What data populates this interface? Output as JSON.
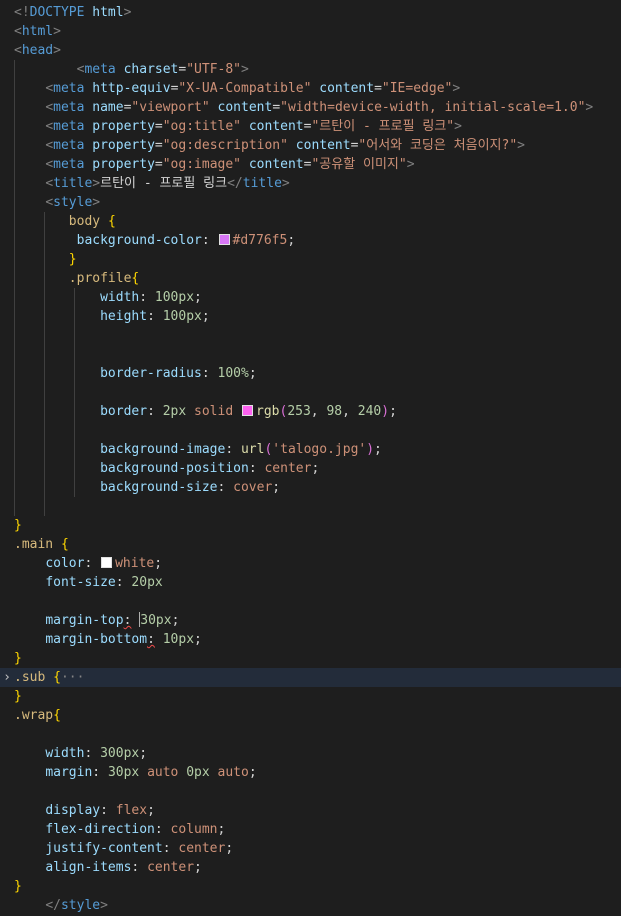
{
  "editor": {
    "theme": {
      "background": "#1e1e1e",
      "current_line": "#232c3a",
      "indent_guide": "#404040"
    },
    "fold_icons": {
      "collapsed": "chevron-right-icon"
    },
    "swatches": {
      "body_bg": "#d776f5",
      "profile_border": "#fd62f0",
      "main_color": "#ffffff"
    },
    "lines": [
      [
        [
          "punct",
          "<!"
        ],
        [
          "tag",
          "DOCTYPE"
        ],
        [
          "text",
          " "
        ],
        [
          "attr",
          "html"
        ],
        [
          "punct",
          ">"
        ]
      ],
      [
        [
          "punct",
          "<"
        ],
        [
          "tag",
          "html"
        ],
        [
          "punct",
          ">"
        ]
      ],
      [
        [
          "punct",
          "<"
        ],
        [
          "tag",
          "head"
        ],
        [
          "punct",
          ">"
        ]
      ],
      [
        [
          "text",
          "        "
        ],
        [
          "punct",
          "<"
        ],
        [
          "tag",
          "meta"
        ],
        [
          "text",
          " "
        ],
        [
          "attr",
          "charset"
        ],
        [
          "text",
          "="
        ],
        [
          "str",
          "\"UTF-8\""
        ],
        [
          "punct",
          ">"
        ]
      ],
      [
        [
          "text",
          "    "
        ],
        [
          "punct",
          "<"
        ],
        [
          "tag",
          "meta"
        ],
        [
          "text",
          " "
        ],
        [
          "attr",
          "http-equiv"
        ],
        [
          "text",
          "="
        ],
        [
          "str",
          "\"X-UA-Compatible\""
        ],
        [
          "text",
          " "
        ],
        [
          "attr",
          "content"
        ],
        [
          "text",
          "="
        ],
        [
          "str",
          "\"IE=edge\""
        ],
        [
          "punct",
          ">"
        ]
      ],
      [
        [
          "text",
          "    "
        ],
        [
          "punct",
          "<"
        ],
        [
          "tag",
          "meta"
        ],
        [
          "text",
          " "
        ],
        [
          "attr",
          "name"
        ],
        [
          "text",
          "="
        ],
        [
          "str",
          "\"viewport\""
        ],
        [
          "text",
          " "
        ],
        [
          "attr",
          "content"
        ],
        [
          "text",
          "="
        ],
        [
          "str",
          "\"width=device-width, initial-scale=1.0\""
        ],
        [
          "punct",
          ">"
        ]
      ],
      [
        [
          "text",
          "    "
        ],
        [
          "punct",
          "<"
        ],
        [
          "tag",
          "meta"
        ],
        [
          "text",
          " "
        ],
        [
          "attr",
          "property"
        ],
        [
          "text",
          "="
        ],
        [
          "str",
          "\"og:title\""
        ],
        [
          "text",
          " "
        ],
        [
          "attr",
          "content"
        ],
        [
          "text",
          "="
        ],
        [
          "str",
          "\"르탄이 - 프로필 링크\""
        ],
        [
          "punct",
          ">"
        ]
      ],
      [
        [
          "text",
          "    "
        ],
        [
          "punct",
          "<"
        ],
        [
          "tag",
          "meta"
        ],
        [
          "text",
          " "
        ],
        [
          "attr",
          "property"
        ],
        [
          "text",
          "="
        ],
        [
          "str",
          "\"og:description\""
        ],
        [
          "text",
          " "
        ],
        [
          "attr",
          "content"
        ],
        [
          "text",
          "="
        ],
        [
          "str",
          "\"어서와 코딩은 처음이지?\""
        ],
        [
          "punct",
          ">"
        ]
      ],
      [
        [
          "text",
          "    "
        ],
        [
          "punct",
          "<"
        ],
        [
          "tag",
          "meta"
        ],
        [
          "text",
          " "
        ],
        [
          "attr",
          "property"
        ],
        [
          "text",
          "="
        ],
        [
          "str",
          "\"og:image\""
        ],
        [
          "text",
          " "
        ],
        [
          "attr",
          "content"
        ],
        [
          "text",
          "="
        ],
        [
          "str",
          "\"공유할 이미지\""
        ],
        [
          "punct",
          ">"
        ]
      ],
      [
        [
          "text",
          "    "
        ],
        [
          "punct",
          "<"
        ],
        [
          "tag",
          "title"
        ],
        [
          "punct",
          ">"
        ],
        [
          "text",
          "르탄이 - 프로필 링크"
        ],
        [
          "punct",
          "</"
        ],
        [
          "tag",
          "title"
        ],
        [
          "punct",
          ">"
        ]
      ],
      [
        [
          "text",
          "    "
        ],
        [
          "punct",
          "<"
        ],
        [
          "tag",
          "style"
        ],
        [
          "punct",
          ">"
        ]
      ],
      [
        [
          "text",
          "       "
        ],
        [
          "sel",
          "body"
        ],
        [
          "text",
          " "
        ],
        [
          "brace",
          "{"
        ]
      ],
      [
        [
          "text",
          "        "
        ],
        [
          "prop",
          "background-color"
        ],
        [
          "text",
          ": "
        ],
        [
          "swatch",
          "body_bg"
        ],
        [
          "val",
          "#d776f5"
        ],
        [
          "text",
          ";"
        ]
      ],
      [
        [
          "text",
          "       "
        ],
        [
          "brace",
          "}"
        ]
      ],
      [
        [
          "text",
          "       "
        ],
        [
          "sel",
          ".profile"
        ],
        [
          "brace",
          "{"
        ]
      ],
      [
        [
          "text",
          "           "
        ],
        [
          "prop",
          "width"
        ],
        [
          "text",
          ": "
        ],
        [
          "num",
          "100px"
        ],
        [
          "text",
          ";"
        ]
      ],
      [
        [
          "text",
          "           "
        ],
        [
          "prop",
          "height"
        ],
        [
          "text",
          ": "
        ],
        [
          "num",
          "100px"
        ],
        [
          "text",
          ";"
        ]
      ],
      [],
      [],
      [
        [
          "text",
          "           "
        ],
        [
          "prop",
          "border-radius"
        ],
        [
          "text",
          ": "
        ],
        [
          "num",
          "100%"
        ],
        [
          "text",
          ";"
        ]
      ],
      [],
      [
        [
          "text",
          "           "
        ],
        [
          "prop",
          "border"
        ],
        [
          "text",
          ": "
        ],
        [
          "num",
          "2px"
        ],
        [
          "text",
          " "
        ],
        [
          "val",
          "solid"
        ],
        [
          "text",
          " "
        ],
        [
          "swatch",
          "profile_border"
        ],
        [
          "func",
          "rgb"
        ],
        [
          "brace2",
          "("
        ],
        [
          "num",
          "253"
        ],
        [
          "text",
          ", "
        ],
        [
          "num",
          "98"
        ],
        [
          "text",
          ", "
        ],
        [
          "num",
          "240"
        ],
        [
          "brace2",
          ")"
        ],
        [
          "text",
          ";"
        ]
      ],
      [],
      [
        [
          "text",
          "           "
        ],
        [
          "prop",
          "background-image"
        ],
        [
          "text",
          ": "
        ],
        [
          "func",
          "url"
        ],
        [
          "brace2",
          "("
        ],
        [
          "str",
          "'talogo.jpg'"
        ],
        [
          "brace2",
          ")"
        ],
        [
          "text",
          ";"
        ]
      ],
      [
        [
          "text",
          "           "
        ],
        [
          "prop",
          "background-position"
        ],
        [
          "text",
          ": "
        ],
        [
          "val",
          "center"
        ],
        [
          "text",
          ";"
        ]
      ],
      [
        [
          "text",
          "           "
        ],
        [
          "prop",
          "background-size"
        ],
        [
          "text",
          ": "
        ],
        [
          "val",
          "cover"
        ],
        [
          "text",
          ";"
        ]
      ],
      [],
      [
        [
          "brace",
          "}"
        ]
      ],
      [
        [
          "sel",
          ".main"
        ],
        [
          "text",
          " "
        ],
        [
          "brace",
          "{"
        ]
      ],
      [
        [
          "text",
          "    "
        ],
        [
          "prop",
          "color"
        ],
        [
          "text",
          ": "
        ],
        [
          "swatch",
          "main_color"
        ],
        [
          "val",
          "white"
        ],
        [
          "text",
          ";"
        ]
      ],
      [
        [
          "text",
          "    "
        ],
        [
          "prop",
          "font-size"
        ],
        [
          "text",
          ": "
        ],
        [
          "num",
          "20px"
        ]
      ],
      [],
      [
        [
          "text",
          "    "
        ],
        [
          "prop",
          "margin-top"
        ],
        [
          "squig",
          ":"
        ],
        [
          "text",
          " "
        ],
        [
          "cursor",
          ""
        ],
        [
          "num",
          "30px"
        ],
        [
          "text",
          ";"
        ]
      ],
      [
        [
          "text",
          "    "
        ],
        [
          "prop",
          "margin-bottom"
        ],
        [
          "squig",
          ":"
        ],
        [
          "text",
          " "
        ],
        [
          "num",
          "10px"
        ],
        [
          "text",
          ";"
        ]
      ],
      [
        [
          "brace",
          "}"
        ]
      ],
      [
        [
          "sel",
          ".sub"
        ],
        [
          "text",
          " "
        ],
        [
          "brace",
          "{"
        ],
        [
          "ellipsis",
          "···"
        ]
      ],
      [
        [
          "brace",
          "}"
        ]
      ],
      [
        [
          "sel",
          ".wrap"
        ],
        [
          "brace",
          "{"
        ]
      ],
      [],
      [
        [
          "text",
          "    "
        ],
        [
          "prop",
          "width"
        ],
        [
          "text",
          ": "
        ],
        [
          "num",
          "300px"
        ],
        [
          "text",
          ";"
        ]
      ],
      [
        [
          "text",
          "    "
        ],
        [
          "prop",
          "margin"
        ],
        [
          "text",
          ": "
        ],
        [
          "num",
          "30px"
        ],
        [
          "text",
          " "
        ],
        [
          "val",
          "auto"
        ],
        [
          "text",
          " "
        ],
        [
          "num",
          "0px"
        ],
        [
          "text",
          " "
        ],
        [
          "val",
          "auto"
        ],
        [
          "text",
          ";"
        ]
      ],
      [],
      [
        [
          "text",
          "    "
        ],
        [
          "prop",
          "display"
        ],
        [
          "text",
          ": "
        ],
        [
          "val",
          "flex"
        ],
        [
          "text",
          ";"
        ]
      ],
      [
        [
          "text",
          "    "
        ],
        [
          "prop",
          "flex-direction"
        ],
        [
          "text",
          ": "
        ],
        [
          "val",
          "column"
        ],
        [
          "text",
          ";"
        ]
      ],
      [
        [
          "text",
          "    "
        ],
        [
          "prop",
          "justify-content"
        ],
        [
          "text",
          ": "
        ],
        [
          "val",
          "center"
        ],
        [
          "text",
          ";"
        ]
      ],
      [
        [
          "text",
          "    "
        ],
        [
          "prop",
          "align-items"
        ],
        [
          "text",
          ": "
        ],
        [
          "val",
          "center"
        ],
        [
          "text",
          ";"
        ]
      ],
      [
        [
          "brace",
          "}"
        ]
      ],
      [
        [
          "text",
          "    "
        ],
        [
          "punct",
          "</"
        ],
        [
          "tag",
          "style"
        ],
        [
          "punct",
          ">"
        ]
      ]
    ]
  }
}
